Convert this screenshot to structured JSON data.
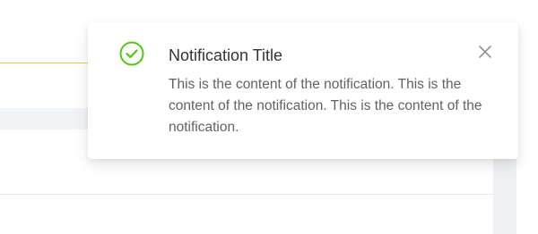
{
  "notification": {
    "status_icon": "check-circle-icon",
    "close_icon": "close-icon",
    "title": "Notification Title",
    "content": "This is the content of the notification. This is the content of the notification. This is the content of the notification."
  },
  "colors": {
    "success": "#52c41a",
    "accent_line": "#f0c75b",
    "title_text": "#333333",
    "body_text": "#606266",
    "close_icon": "#909399"
  }
}
